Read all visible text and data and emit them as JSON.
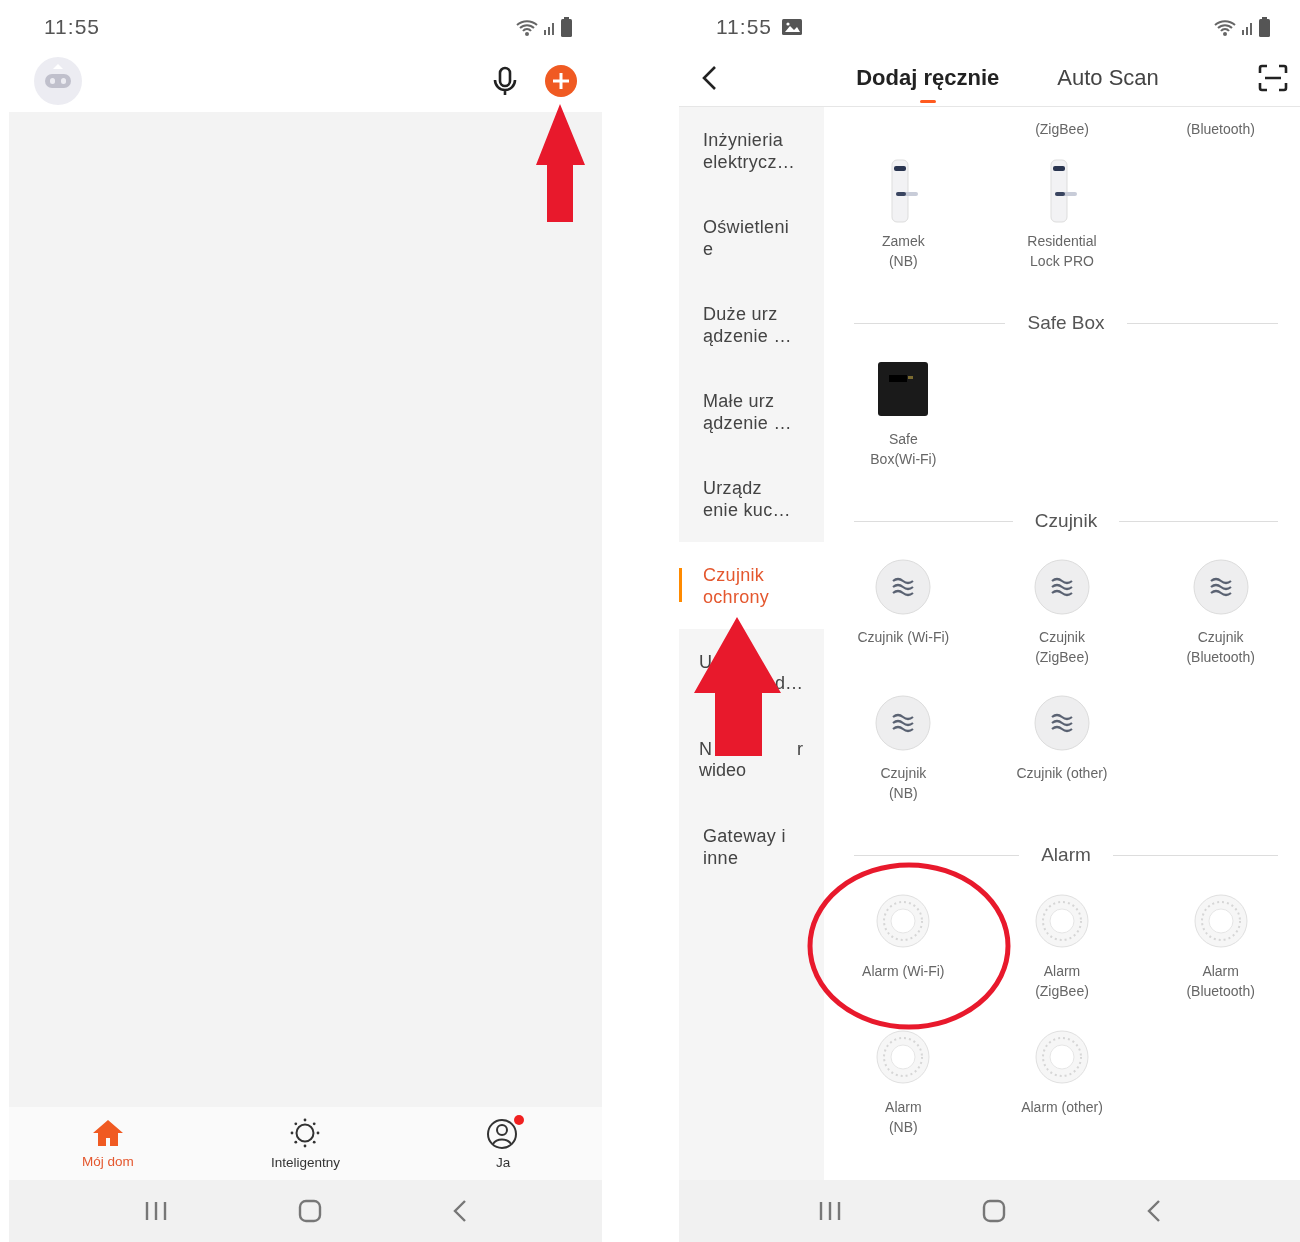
{
  "left_screen": {
    "status_bar": {
      "time": "11:55"
    },
    "bottom_tabs": [
      {
        "label": "Mój dom",
        "selected": true,
        "badge": false
      },
      {
        "label": "Inteligentny",
        "selected": false,
        "badge": false
      },
      {
        "label": "Ja",
        "selected": false,
        "badge": true
      }
    ]
  },
  "right_screen": {
    "status_bar": {
      "time": "11:55"
    },
    "tabs": [
      {
        "label": "Dodaj ręcznie",
        "selected": true
      },
      {
        "label": "Auto Scan",
        "selected": false
      }
    ],
    "sidebar": [
      {
        "kind": "text",
        "label": "Inżynieria\nelektrycz…",
        "selected": false
      },
      {
        "kind": "text",
        "label": "Oświetleni\ne",
        "selected": false
      },
      {
        "kind": "text",
        "label": "Duże urz\nądzenie …",
        "selected": false
      },
      {
        "kind": "text",
        "label": "Małe urz\nądzenie …",
        "selected": false
      },
      {
        "kind": "text",
        "label": "Urządz\nenie kuc…",
        "selected": false
      },
      {
        "kind": "text",
        "label": "Czujnik\nochrony",
        "selected": true
      },
      {
        "kind": "obscured",
        "rows": [
          {
            "left": "U"
          },
          {
            "right": "d…"
          }
        ],
        "selected": false
      },
      {
        "kind": "obscured",
        "rows": [
          {
            "left": "N",
            "right": "r"
          },
          {
            "left": "wideo"
          }
        ],
        "selected": false
      },
      {
        "kind": "text",
        "label": "Gateway i\ninne",
        "selected": false
      }
    ],
    "sections": [
      {
        "items": [
          {
            "kind": "clipped"
          },
          {
            "kind": "clipped",
            "label": "(ZigBee)"
          },
          {
            "kind": "clipped",
            "label": "(Bluetooth)"
          },
          {
            "kind": "lock",
            "label": "Zamek\n(NB)"
          },
          {
            "kind": "lock",
            "label": "Residential\nLock PRO"
          }
        ]
      },
      {
        "title": "Safe Box",
        "items": [
          {
            "kind": "safe",
            "label": "Safe\nBox(Wi-Fi)"
          }
        ]
      },
      {
        "title": "Czujnik",
        "items": [
          {
            "kind": "sensor",
            "label": "Czujnik (Wi-Fi)"
          },
          {
            "kind": "sensor",
            "label": "Czujnik\n(ZigBee)"
          },
          {
            "kind": "sensor",
            "label": "Czujnik\n(Bluetooth)"
          },
          {
            "kind": "sensor",
            "label": "Czujnik\n(NB)"
          },
          {
            "kind": "sensor",
            "label": "Czujnik (other)"
          }
        ]
      },
      {
        "title": "Alarm",
        "items": [
          {
            "kind": "alarm",
            "label": "Alarm (Wi-Fi)"
          },
          {
            "kind": "alarm",
            "label": "Alarm\n(ZigBee)"
          },
          {
            "kind": "alarm",
            "label": "Alarm\n(Bluetooth)"
          },
          {
            "kind": "alarm",
            "label": "Alarm\n(NB)"
          },
          {
            "kind": "alarm",
            "label": "Alarm (other)"
          }
        ]
      }
    ]
  }
}
